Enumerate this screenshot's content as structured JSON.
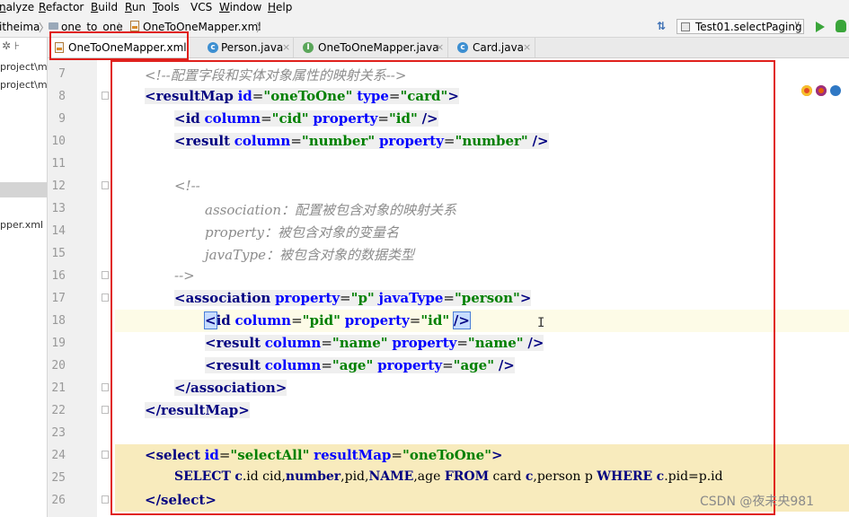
{
  "menu": [
    "nalyze",
    "Refactor",
    "Build",
    "Run",
    "Tools",
    "VCS",
    "Window",
    "Help"
  ],
  "menu_underline": [
    "n",
    "R",
    "B",
    "R",
    "T",
    "",
    "W",
    "H"
  ],
  "breadcrumb": [
    "itheima",
    "one_to_one",
    "OneToOneMapper.xml"
  ],
  "run_config": {
    "label": "Test01.selectPaging"
  },
  "project_panel": {
    "rows": [
      "project\\m",
      "project\\m",
      "pper.xml"
    ]
  },
  "tabs": [
    {
      "label": "OneToOneMapper.xml",
      "icon": "xml-file-icon"
    },
    {
      "label": "Person.java",
      "icon": "class-icon"
    },
    {
      "label": "OneToOneMapper.java",
      "icon": "interface-icon"
    },
    {
      "label": "Card.java",
      "icon": "class-icon"
    }
  ],
  "tab_close": "×",
  "editor": {
    "line_numbers": [
      "7",
      "8",
      "9",
      "10",
      "11",
      "12",
      "13",
      "14",
      "15",
      "16",
      "17",
      "18",
      "19",
      "20",
      "21",
      "22",
      "23",
      "24",
      "25",
      "26"
    ],
    "comment_lines": {
      "c7": "<!--配置字段和实体对象属性的映射关系-->",
      "c12": "<!--",
      "c13": "association：配置被包含对象的映射关系",
      "c14": "property：被包含对象的变量名",
      "c15": "javaType：被包含对象的数据类型",
      "c16": "-->"
    },
    "tokens": {
      "resultMap": "resultMap",
      "id": "id",
      "oneToOne": "\"oneToOne\"",
      "type": "type",
      "card": "\"card\"",
      "column": "column",
      "cid": "\"cid\"",
      "property": "property",
      "id_val": "\"id\"",
      "result": "result",
      "number_val": "\"number\"",
      "association": "association",
      "p": "\"p\"",
      "javaType": "javaType",
      "person": "\"person\"",
      "pid": "\"pid\"",
      "name_val": "\"name\"",
      "age_val": "\"age\"",
      "select": "select",
      "selectAll": "\"selectAll\"",
      "sql_select": "SELECT",
      "sql_c1": "c",
      "sql_a": ".id cid,",
      "sql_number": "number",
      "sql_b": ",pid,",
      "sql_name": "NAME",
      "sql_c": ",age ",
      "sql_from": "FROM",
      "sql_d": " card ",
      "sql_c2": "c",
      "sql_e": ",person p ",
      "sql_where": "WHERE",
      "sql_c3": "c",
      "sql_f": ".pid=p.id"
    }
  },
  "watermark": "CSDN @夜未央981"
}
